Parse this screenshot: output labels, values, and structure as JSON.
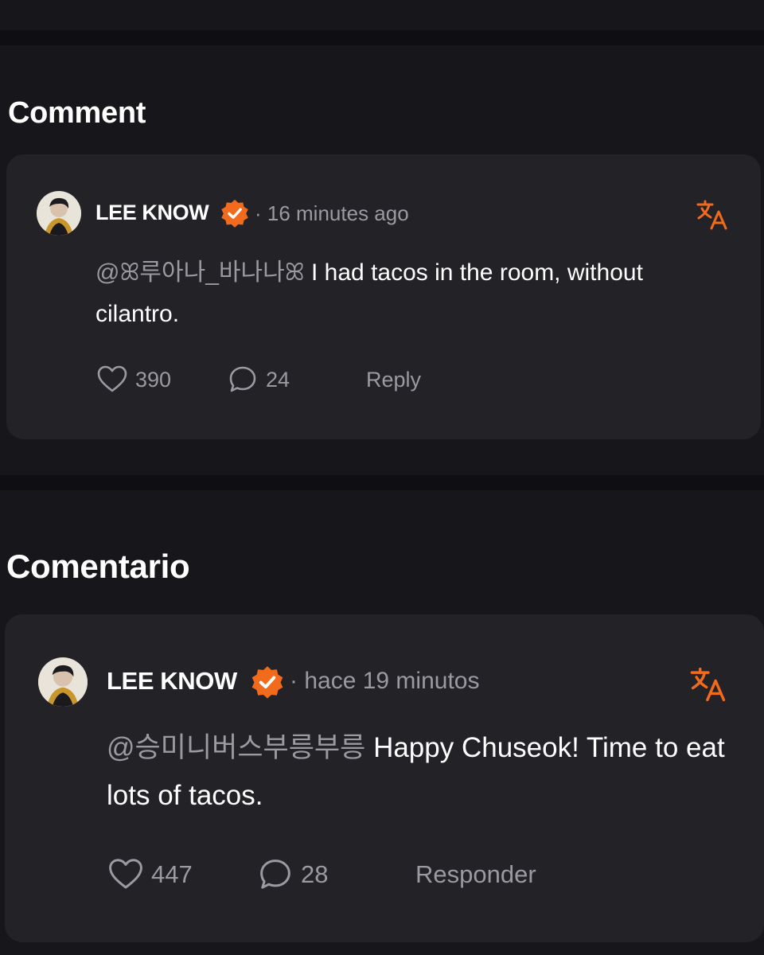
{
  "sections": [
    {
      "title": "Comment",
      "comment": {
        "author": "LEE KNOW",
        "time": "· 16 minutes ago",
        "mention": "@ꕤ루아나_바나나ꕤ",
        "text": " I had tacos in the room, without cilantro.",
        "likes": "390",
        "replies": "24",
        "reply_label": "Reply"
      }
    },
    {
      "title": "Comentario",
      "comment": {
        "author": "LEE KNOW",
        "time": "· hace 19 minutos",
        "mention": "@승미니버스부릉부릉",
        "text": " Happy Chuseok! Time to eat lots of tacos.",
        "likes": "447",
        "replies": "28",
        "reply_label": "Responder"
      }
    }
  ],
  "icons": {
    "verified": "verified-badge-icon",
    "translate": "translate-icon",
    "like": "heart-icon",
    "comment": "comment-bubble-icon"
  },
  "colors": {
    "background": "#0f0f12",
    "panel": "#17171b",
    "card": "#222227",
    "accent": "#f26b1d",
    "muted_text": "#9a9aa0",
    "text": "#ffffff"
  }
}
